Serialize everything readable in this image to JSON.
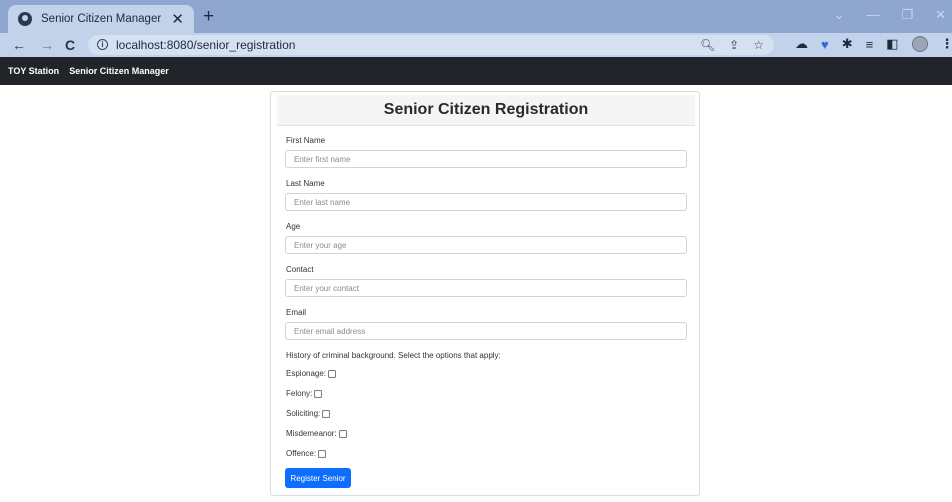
{
  "browser": {
    "tab_title": "Senior Citizen Manager",
    "tab_close": "✕",
    "new_tab": "+",
    "url": "localhost:8080/senior_registration",
    "window_controls": [
      "⌄",
      "—",
      "❐",
      "✕"
    ]
  },
  "navbar": {
    "brand": "TOY Station",
    "link": "Senior Citizen Manager"
  },
  "form": {
    "title": "Senior Citizen Registration",
    "fields": [
      {
        "label": "First Name",
        "placeholder": "Enter first name"
      },
      {
        "label": "Last Name",
        "placeholder": "Enter last name"
      },
      {
        "label": "Age",
        "placeholder": "Enter your age"
      },
      {
        "label": "Contact",
        "placeholder": "Enter your contact"
      },
      {
        "label": "Email",
        "placeholder": "Enter email address"
      }
    ],
    "history_label": "History of criminal background. Select the options that apply:",
    "options": [
      {
        "label": "Espionage:",
        "checked": false
      },
      {
        "label": "Felony:",
        "checked": false
      },
      {
        "label": "Soliciting:",
        "checked": false
      },
      {
        "label": "Misdemeanor:",
        "checked": false
      },
      {
        "label": "Offence:",
        "checked": false
      }
    ],
    "submit_label": "Register Senior"
  },
  "colors": {
    "navbar_bg": "#212529",
    "button_bg": "#0d6efd",
    "tabstrip_bg": "#8fa7cf",
    "toolbar_bg": "#c2d2ea"
  }
}
